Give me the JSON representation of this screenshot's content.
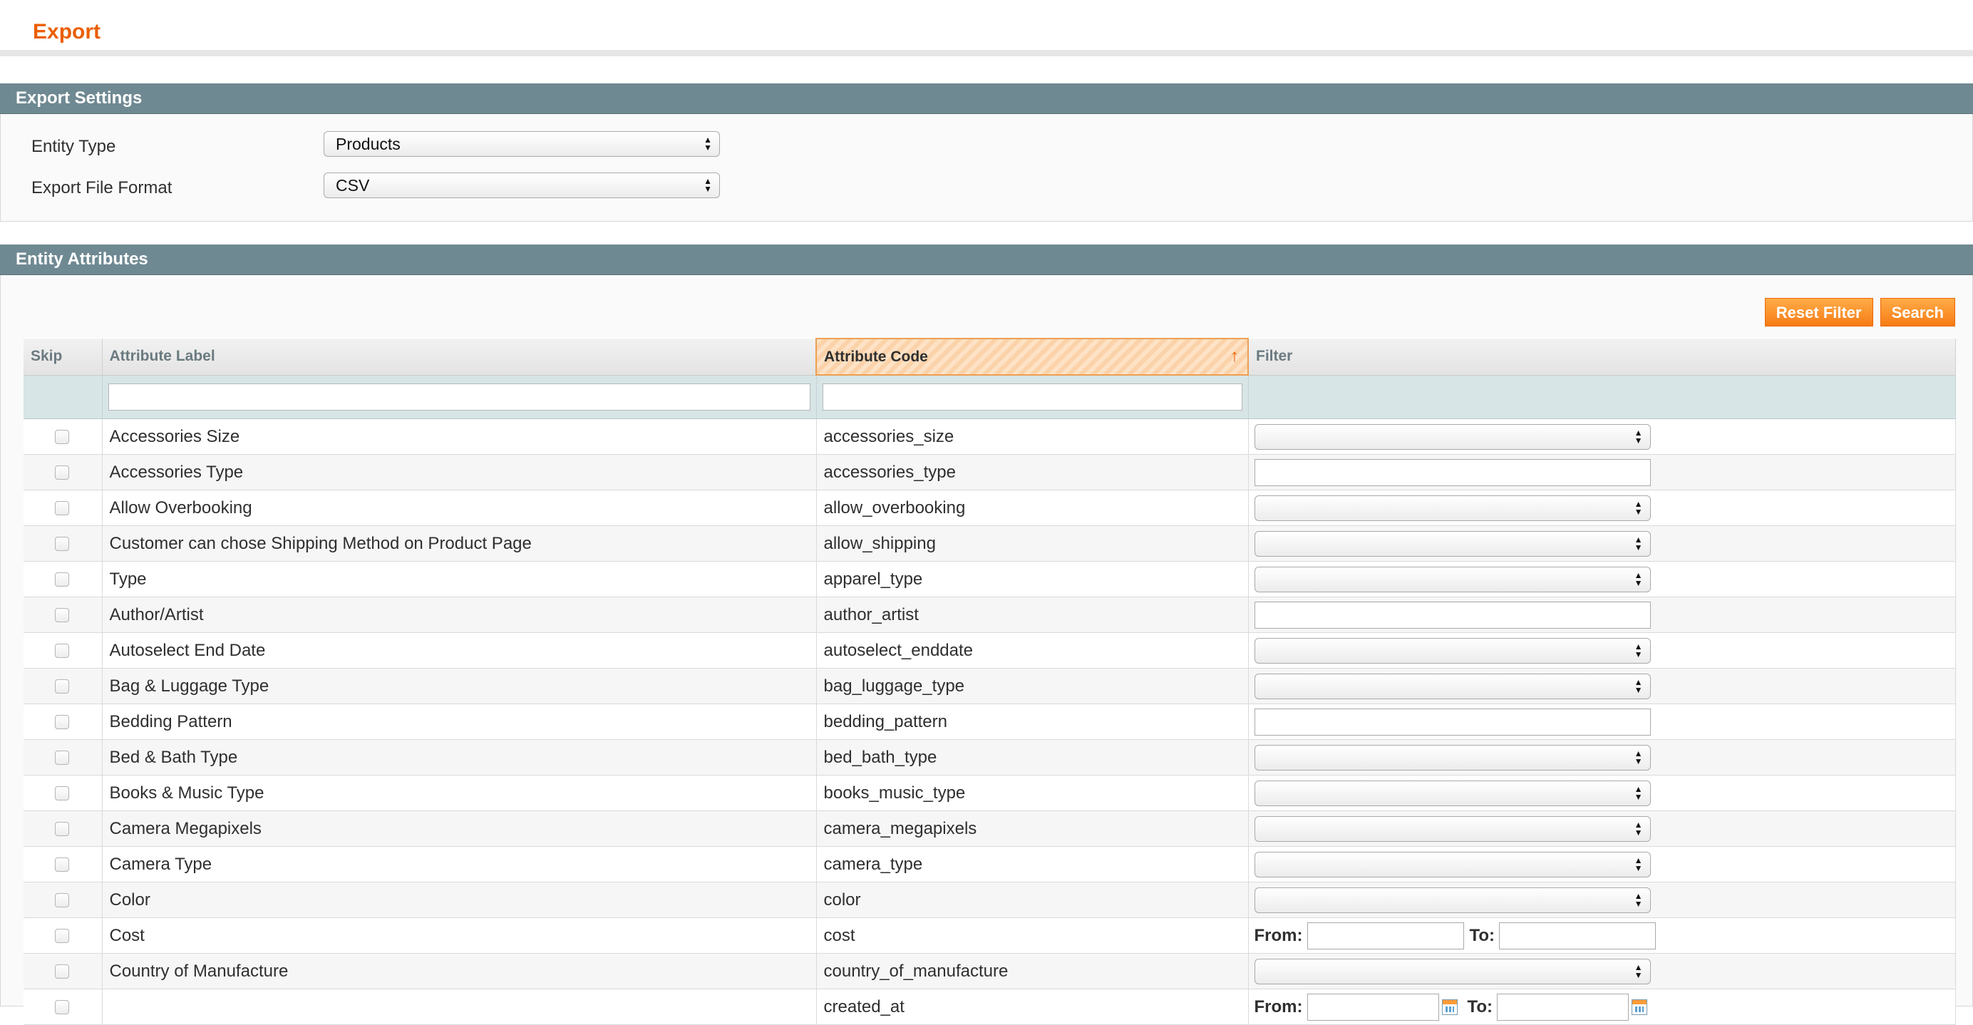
{
  "page": {
    "title": "Export"
  },
  "export_settings": {
    "heading": "Export Settings",
    "entity_type": {
      "label": "Entity Type",
      "value": "Products"
    },
    "file_format": {
      "label": "Export File Format",
      "value": "CSV"
    }
  },
  "entity_attributes": {
    "heading": "Entity Attributes",
    "buttons": {
      "reset_filter": "Reset Filter",
      "search": "Search"
    },
    "columns": {
      "skip": "Skip",
      "label": "Attribute Label",
      "code": "Attribute Code",
      "filter": "Filter"
    },
    "sort_icon": "arrow-up-icon",
    "range_from": "From:",
    "range_to": "To:",
    "rows": [
      {
        "label": "Accessories Size",
        "code": "accessories_size",
        "filter": "select"
      },
      {
        "label": "Accessories Type",
        "code": "accessories_type",
        "filter": "text"
      },
      {
        "label": "Allow Overbooking",
        "code": "allow_overbooking",
        "filter": "select"
      },
      {
        "label": "Customer can chose Shipping Method on Product Page",
        "code": "allow_shipping",
        "filter": "select"
      },
      {
        "label": "Type",
        "code": "apparel_type",
        "filter": "select"
      },
      {
        "label": "Author/Artist",
        "code": "author_artist",
        "filter": "text"
      },
      {
        "label": "Autoselect End Date",
        "code": "autoselect_enddate",
        "filter": "select"
      },
      {
        "label": "Bag & Luggage Type",
        "code": "bag_luggage_type",
        "filter": "select"
      },
      {
        "label": "Bedding Pattern",
        "code": "bedding_pattern",
        "filter": "text"
      },
      {
        "label": "Bed & Bath Type",
        "code": "bed_bath_type",
        "filter": "select"
      },
      {
        "label": "Books & Music Type",
        "code": "books_music_type",
        "filter": "select"
      },
      {
        "label": "Camera Megapixels",
        "code": "camera_megapixels",
        "filter": "select"
      },
      {
        "label": "Camera Type",
        "code": "camera_type",
        "filter": "select"
      },
      {
        "label": "Color",
        "code": "color",
        "filter": "select"
      },
      {
        "label": "Cost",
        "code": "cost",
        "filter": "range"
      },
      {
        "label": "Country of Manufacture",
        "code": "country_of_manufacture",
        "filter": "select"
      },
      {
        "label": "",
        "code": "created_at",
        "filter": "date-range"
      }
    ]
  }
}
